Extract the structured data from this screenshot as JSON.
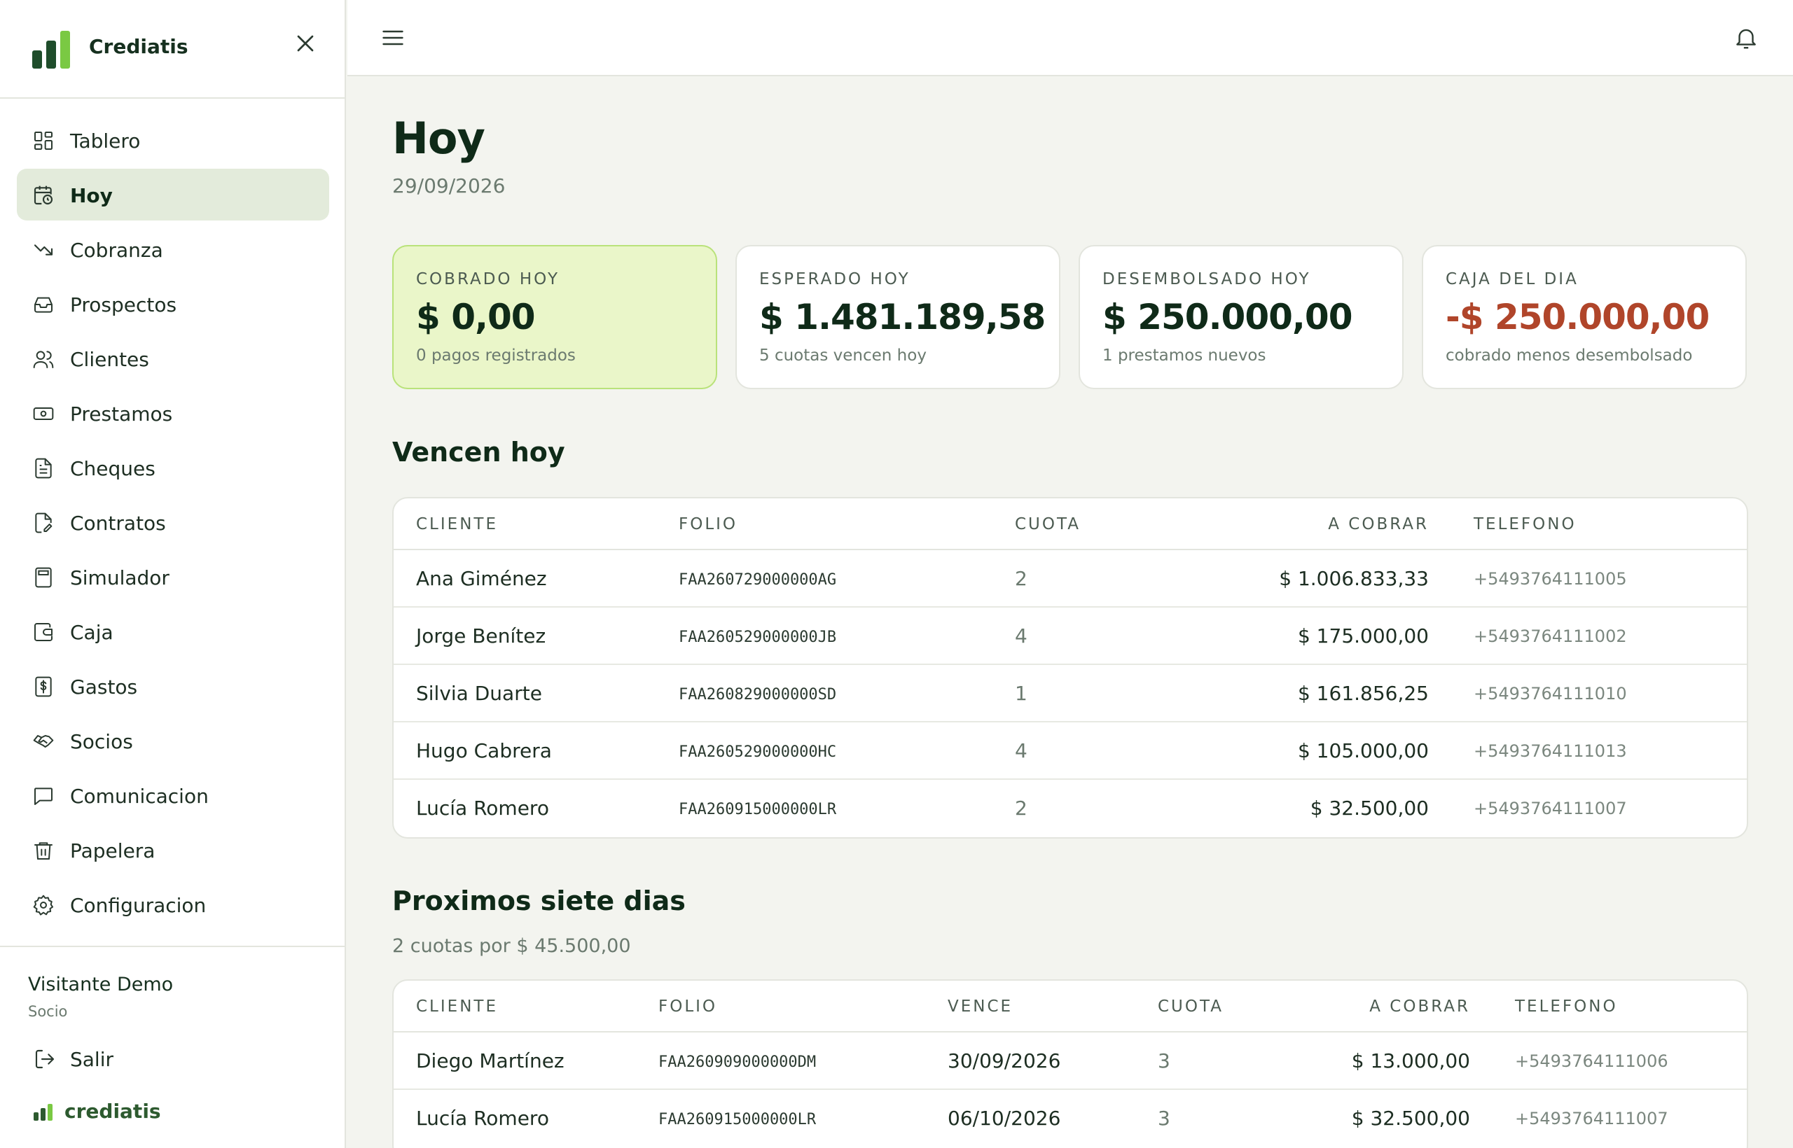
{
  "app": {
    "name": "Crediatis",
    "footer_name": "crediatis"
  },
  "colors": {
    "accent_dark": "#1f4d2b",
    "accent_light": "#7ac943",
    "highlight_bg": "#eaf6c9",
    "negative": "#b0452a"
  },
  "sidebar": {
    "items": [
      {
        "label": "Tablero",
        "icon": "dashboard-icon"
      },
      {
        "label": "Hoy",
        "icon": "calendar-clock-icon"
      },
      {
        "label": "Cobranza",
        "icon": "trending-down-icon"
      },
      {
        "label": "Prospectos",
        "icon": "inbox-icon"
      },
      {
        "label": "Clientes",
        "icon": "users-icon"
      },
      {
        "label": "Prestamos",
        "icon": "banknote-icon"
      },
      {
        "label": "Cheques",
        "icon": "document-icon"
      },
      {
        "label": "Contratos",
        "icon": "file-signature-icon"
      },
      {
        "label": "Simulador",
        "icon": "calculator-icon"
      },
      {
        "label": "Caja",
        "icon": "wallet-icon"
      },
      {
        "label": "Gastos",
        "icon": "receipt-dollar-icon"
      },
      {
        "label": "Socios",
        "icon": "handshake-icon"
      },
      {
        "label": "Comunicacion",
        "icon": "chat-icon"
      },
      {
        "label": "Papelera",
        "icon": "trash-icon"
      },
      {
        "label": "Configuracion",
        "icon": "gear-icon"
      }
    ],
    "active": "Hoy",
    "user": {
      "name": "Visitante Demo",
      "role": "Socio"
    },
    "logout_label": "Salir"
  },
  "page": {
    "title": "Hoy",
    "date": "29/09/2026"
  },
  "cards": [
    {
      "label": "COBRADO HOY",
      "value": "$ 0,00",
      "sub": "0 pagos registrados"
    },
    {
      "label": "ESPERADO HOY",
      "value": "$ 1.481.189,58",
      "sub": "5 cuotas vencen hoy"
    },
    {
      "label": "DESEMBOLSADO HOY",
      "value": "$ 250.000,00",
      "sub": "1 prestamos nuevos"
    },
    {
      "label": "CAJA DEL DIA",
      "value": "-$ 250.000,00",
      "sub": "cobrado menos desembolsado"
    }
  ],
  "today": {
    "title": "Vencen hoy",
    "headers": {
      "cliente": "CLIENTE",
      "folio": "FOLIO",
      "cuota": "CUOTA",
      "cobrar": "A COBRAR",
      "telefono": "TELEFONO"
    },
    "rows": [
      {
        "cliente": "Ana Giménez",
        "folio": "FAA260729000000AG",
        "cuota": "2",
        "cobrar": "$ 1.006.833,33",
        "telefono": "+5493764111005"
      },
      {
        "cliente": "Jorge Benítez",
        "folio": "FAA260529000000JB",
        "cuota": "4",
        "cobrar": "$ 175.000,00",
        "telefono": "+5493764111002"
      },
      {
        "cliente": "Silvia Duarte",
        "folio": "FAA260829000000SD",
        "cuota": "1",
        "cobrar": "$ 161.856,25",
        "telefono": "+5493764111010"
      },
      {
        "cliente": "Hugo Cabrera",
        "folio": "FAA260529000000HC",
        "cuota": "4",
        "cobrar": "$ 105.000,00",
        "telefono": "+5493764111013"
      },
      {
        "cliente": "Lucía Romero",
        "folio": "FAA260915000000LR",
        "cuota": "2",
        "cobrar": "$ 32.500,00",
        "telefono": "+5493764111007"
      }
    ]
  },
  "week": {
    "title": "Proximos siete dias",
    "subtitle": "2 cuotas por $ 45.500,00",
    "headers": {
      "cliente": "CLIENTE",
      "folio": "FOLIO",
      "vence": "VENCE",
      "cuota": "CUOTA",
      "cobrar": "A COBRAR",
      "telefono": "TELEFONO"
    },
    "rows": [
      {
        "cliente": "Diego Martínez",
        "folio": "FAA260909000000DM",
        "vence": "30/09/2026",
        "cuota": "3",
        "cobrar": "$ 13.000,00",
        "telefono": "+5493764111006"
      },
      {
        "cliente": "Lucía Romero",
        "folio": "FAA260915000000LR",
        "vence": "06/10/2026",
        "cuota": "3",
        "cobrar": "$ 32.500,00",
        "telefono": "+5493764111007"
      }
    ]
  }
}
